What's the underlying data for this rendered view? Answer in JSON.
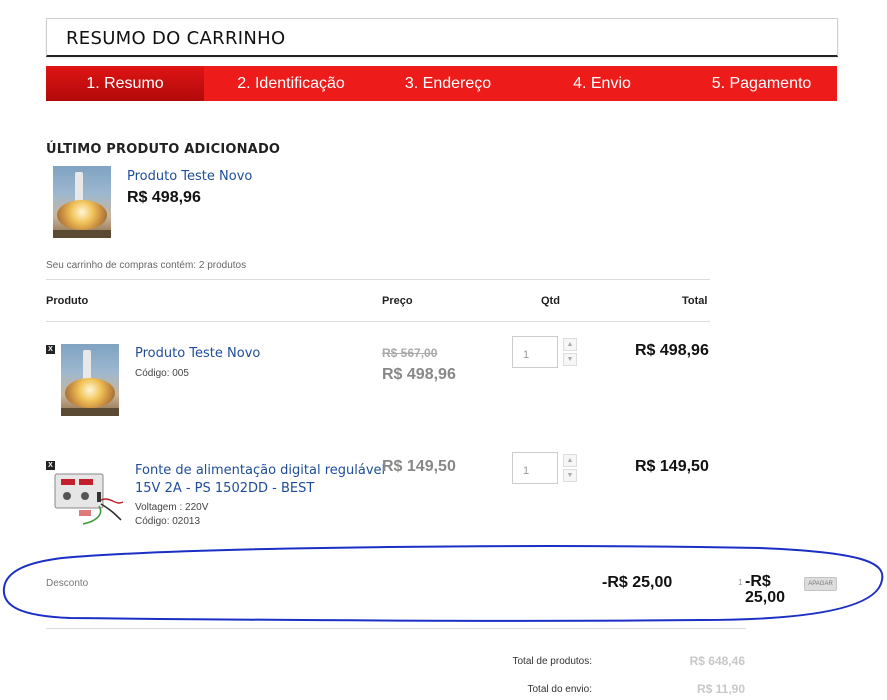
{
  "page": {
    "title": "RESUMO DO CARRINHO"
  },
  "steps": [
    {
      "label": "1. Resumo",
      "active": true
    },
    {
      "label": "2. Identificação",
      "active": false
    },
    {
      "label": "3. Endereço",
      "active": false
    },
    {
      "label": "4. Envio",
      "active": false
    },
    {
      "label": "5. Pagamento",
      "active": false
    }
  ],
  "last_added": {
    "heading": "ÚLTIMO PRODUTO ADICIONADO",
    "name": "Produto Teste Novo",
    "price": "R$ 498,96"
  },
  "cart": {
    "count_text": "Seu carrinho de compras contém: 2 produtos",
    "headers": {
      "product": "Produto",
      "price": "Preço",
      "qty": "Qtd",
      "total": "Total"
    },
    "items": [
      {
        "delete": "X",
        "name": "Produto Teste Novo",
        "meta": [
          "Código: 005"
        ],
        "price_old": "R$ 567,00",
        "price": "R$ 498,96",
        "qty": "1",
        "total": "R$ 498,96"
      },
      {
        "delete": "X",
        "name_lines": [
          "Fonte de alimentação digital regulável",
          "15V 2A - PS 1502DD - BEST"
        ],
        "meta": [
          "Voltagem : 220V",
          "Código: 02013"
        ],
        "price_old": "",
        "price": "R$ 149,50",
        "qty": "1",
        "total": "R$ 149,50"
      }
    ],
    "discount": {
      "label": "Desconto",
      "value": "-R$ 25,00",
      "qty": "1",
      "total_lines": [
        "-R$",
        "25,00"
      ],
      "delete_label": "APAGAR"
    },
    "summary": [
      {
        "label": "Total de produtos:",
        "value": "R$ 648,46"
      },
      {
        "label": "Total do envio:",
        "value": "R$ 11,90"
      }
    ]
  },
  "colors": {
    "accent_red": "#ee1b1b",
    "link_blue": "#1f4d99",
    "annotation_blue": "#1b2fc4"
  }
}
